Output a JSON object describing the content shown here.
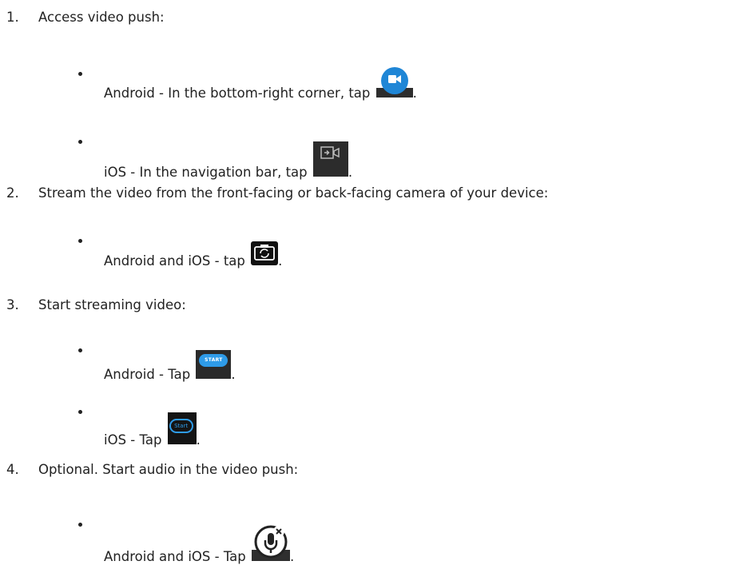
{
  "steps": [
    {
      "number": "1.",
      "text": "Access video push:",
      "bullets": [
        {
          "text": "Android - In the bottom-right corner, tap",
          "icon": "video-camera-icon",
          "end": "."
        },
        {
          "text": "iOS - In the navigation bar, tap",
          "icon": "video-push-icon",
          "end": "."
        }
      ]
    },
    {
      "number": "2.",
      "text": "Stream the video from the front-facing or back-facing camera of your device:",
      "bullets": [
        {
          "text": "Android and iOS - tap",
          "icon": "camera-switch-icon",
          "end": "."
        }
      ]
    },
    {
      "number": "3.",
      "text": "Start streaming video:",
      "bullets": [
        {
          "text": "Android - Tap",
          "icon": "start-button-icon",
          "icon_label": "START",
          "end": "."
        },
        {
          "text": "iOS - Tap",
          "icon": "start-button-icon",
          "icon_label": "Start",
          "end": "."
        }
      ]
    },
    {
      "number": "4.",
      "text": "Optional. Start audio in the video push:",
      "bullets": [
        {
          "text": "Android and iOS - Tap",
          "icon": "microphone-muted-icon",
          "end": "."
        }
      ]
    }
  ],
  "colors": {
    "text": "#222222",
    "accent_blue": "#1f86d6",
    "icon_dark": "#2d2d2d"
  }
}
